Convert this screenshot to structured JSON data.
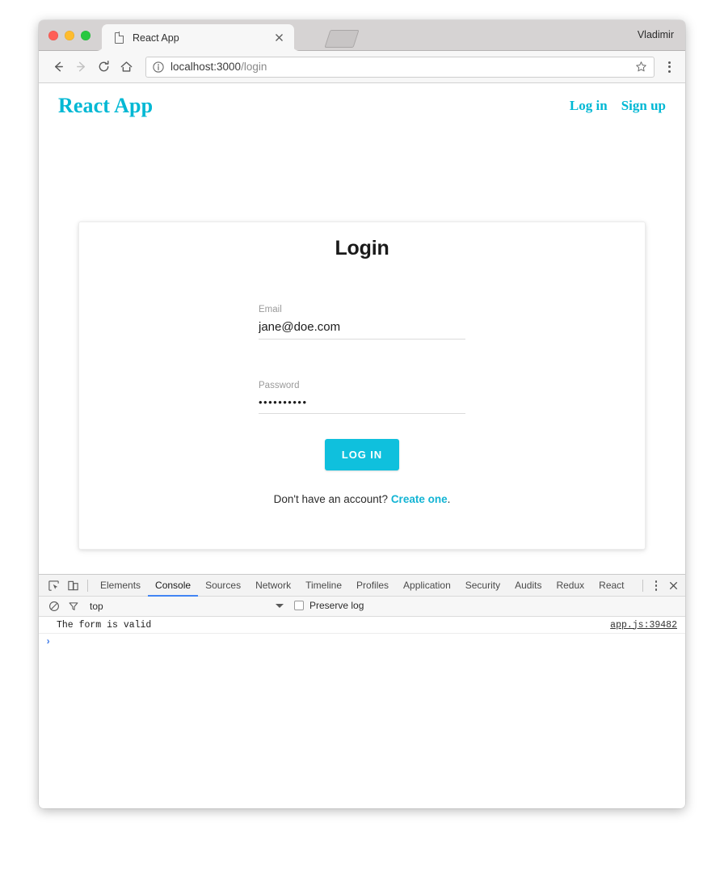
{
  "browser": {
    "tab": {
      "title": "React App",
      "favicon_icon": "page-icon",
      "close_icon": "close-icon"
    },
    "new_tab_icon": "new-tab-icon",
    "profile_name": "Vladimir",
    "toolbar": {
      "back_icon": "back-arrow-icon",
      "forward_icon": "forward-arrow-icon",
      "reload_icon": "reload-icon",
      "home_icon": "home-icon",
      "security_icon": "info-circle-icon",
      "url_host": "localhost:3000",
      "url_path": "/login",
      "url_full": "localhost:3000/login",
      "bookmark_icon": "star-icon",
      "menu_icon": "kebab-menu-icon"
    }
  },
  "page": {
    "brand": "React App",
    "nav_links": [
      {
        "label": "Log in",
        "name": "nav-link-log-in"
      },
      {
        "label": "Sign up",
        "name": "nav-link-sign-up"
      }
    ],
    "card": {
      "title": "Login",
      "fields": [
        {
          "label": "Email",
          "value": "jane@doe.com",
          "placeholder": "Email",
          "type": "email"
        },
        {
          "label": "Password",
          "value": "••••••••••",
          "placeholder": "Password",
          "type": "password"
        }
      ],
      "submit_label": "LOG IN",
      "footer_prefix": "Don't have an account? ",
      "footer_link": "Create one",
      "footer_suffix": "."
    },
    "accent_color": "#00b8d4",
    "button_color": "#0fc0dd"
  },
  "devtools": {
    "inspect_icon": "inspect-element-icon",
    "device_toolbar_icon": "device-toolbar-icon",
    "tabs": [
      {
        "label": "Elements",
        "active": false
      },
      {
        "label": "Console",
        "active": true
      },
      {
        "label": "Sources",
        "active": false
      },
      {
        "label": "Network",
        "active": false
      },
      {
        "label": "Timeline",
        "active": false
      },
      {
        "label": "Profiles",
        "active": false
      },
      {
        "label": "Application",
        "active": false
      },
      {
        "label": "Security",
        "active": false
      },
      {
        "label": "Audits",
        "active": false
      },
      {
        "label": "Redux",
        "active": false
      },
      {
        "label": "React",
        "active": false
      }
    ],
    "more_icon": "kebab-menu-icon",
    "close_icon": "close-icon",
    "console": {
      "clear_icon": "clear-console-icon",
      "filter_icon": "filter-funnel-icon",
      "context": "top",
      "context_caret_icon": "chevron-down-icon",
      "preserve_log_label": "Preserve log",
      "preserve_log_checked": false,
      "messages": [
        {
          "text": "The form is valid",
          "source": "app.js:39482"
        }
      ],
      "prompt_caret": "›",
      "active_tab_underline_color": "#4285f4"
    }
  }
}
